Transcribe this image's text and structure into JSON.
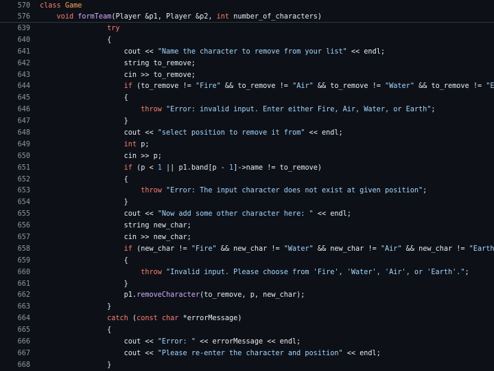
{
  "sticky_header": [
    {
      "line_number": "570",
      "tokens": [
        {
          "t": "class",
          "c": "kw"
        },
        {
          "t": " ",
          "c": "pl"
        },
        {
          "t": "Game",
          "c": "cls"
        }
      ]
    },
    {
      "line_number": "576",
      "tokens": [
        {
          "t": "    ",
          "c": "pl"
        },
        {
          "t": "void",
          "c": "kw"
        },
        {
          "t": " ",
          "c": "pl"
        },
        {
          "t": "formTeam",
          "c": "fn"
        },
        {
          "t": "(Player &p1, Player &p2, ",
          "c": "pl"
        },
        {
          "t": "int",
          "c": "kw"
        },
        {
          "t": " number_of_characters)",
          "c": "pl"
        }
      ]
    }
  ],
  "lines": [
    {
      "line_number": "639",
      "tokens": [
        {
          "t": "                ",
          "c": "pl"
        },
        {
          "t": "try",
          "c": "kw"
        }
      ]
    },
    {
      "line_number": "640",
      "tokens": [
        {
          "t": "                {",
          "c": "pl"
        }
      ]
    },
    {
      "line_number": "641",
      "tokens": [
        {
          "t": "                    cout << ",
          "c": "pl"
        },
        {
          "t": "\"Name the character to remove from your list\"",
          "c": "str"
        },
        {
          "t": " << endl;",
          "c": "pl"
        }
      ]
    },
    {
      "line_number": "642",
      "tokens": [
        {
          "t": "                    string to_remove;",
          "c": "pl"
        }
      ]
    },
    {
      "line_number": "643",
      "tokens": [
        {
          "t": "                    cin >> to_remove;",
          "c": "pl"
        }
      ]
    },
    {
      "line_number": "644",
      "tokens": [
        {
          "t": "                    ",
          "c": "pl"
        },
        {
          "t": "if",
          "c": "kw"
        },
        {
          "t": " (to_remove != ",
          "c": "pl"
        },
        {
          "t": "\"Fire\"",
          "c": "str"
        },
        {
          "t": " && to_remove != ",
          "c": "pl"
        },
        {
          "t": "\"Air\"",
          "c": "str"
        },
        {
          "t": " && to_remove != ",
          "c": "pl"
        },
        {
          "t": "\"Water\"",
          "c": "str"
        },
        {
          "t": " && to_remove != ",
          "c": "pl"
        },
        {
          "t": "\"Earth\"",
          "c": "str"
        },
        {
          "t": ")",
          "c": "pl"
        }
      ]
    },
    {
      "line_number": "645",
      "tokens": [
        {
          "t": "                    {",
          "c": "pl"
        }
      ]
    },
    {
      "line_number": "646",
      "tokens": [
        {
          "t": "                        ",
          "c": "pl"
        },
        {
          "t": "throw",
          "c": "kw"
        },
        {
          "t": " ",
          "c": "pl"
        },
        {
          "t": "\"Error: invalid input. Enter either Fire, Air, Water, or Earth\"",
          "c": "str"
        },
        {
          "t": ";",
          "c": "pl"
        }
      ]
    },
    {
      "line_number": "647",
      "tokens": [
        {
          "t": "                    }",
          "c": "pl"
        }
      ]
    },
    {
      "line_number": "648",
      "tokens": [
        {
          "t": "                    cout << ",
          "c": "pl"
        },
        {
          "t": "\"select position to remove it from\"",
          "c": "str"
        },
        {
          "t": " << endl;",
          "c": "pl"
        }
      ]
    },
    {
      "line_number": "649",
      "tokens": [
        {
          "t": "                    ",
          "c": "pl"
        },
        {
          "t": "int",
          "c": "kw"
        },
        {
          "t": " p;",
          "c": "pl"
        }
      ]
    },
    {
      "line_number": "650",
      "tokens": [
        {
          "t": "                    cin >> p;",
          "c": "pl"
        }
      ]
    },
    {
      "line_number": "651",
      "tokens": [
        {
          "t": "                    ",
          "c": "pl"
        },
        {
          "t": "if",
          "c": "kw"
        },
        {
          "t": " (p < ",
          "c": "pl"
        },
        {
          "t": "1",
          "c": "num"
        },
        {
          "t": " || p1.band[p - ",
          "c": "pl"
        },
        {
          "t": "1",
          "c": "num"
        },
        {
          "t": "]->name != to_remove)",
          "c": "pl"
        }
      ]
    },
    {
      "line_number": "652",
      "tokens": [
        {
          "t": "                    {",
          "c": "pl"
        }
      ]
    },
    {
      "line_number": "653",
      "tokens": [
        {
          "t": "                        ",
          "c": "pl"
        },
        {
          "t": "throw",
          "c": "kw"
        },
        {
          "t": " ",
          "c": "pl"
        },
        {
          "t": "\"Error: The input character does not exist at given position\"",
          "c": "str"
        },
        {
          "t": ";",
          "c": "pl"
        }
      ]
    },
    {
      "line_number": "654",
      "tokens": [
        {
          "t": "                    }",
          "c": "pl"
        }
      ]
    },
    {
      "line_number": "655",
      "tokens": [
        {
          "t": "                    cout << ",
          "c": "pl"
        },
        {
          "t": "\"Now add some other character here: \"",
          "c": "str"
        },
        {
          "t": " << endl;",
          "c": "pl"
        }
      ]
    },
    {
      "line_number": "656",
      "tokens": [
        {
          "t": "                    string new_char;",
          "c": "pl"
        }
      ]
    },
    {
      "line_number": "657",
      "tokens": [
        {
          "t": "                    cin >> new_char;",
          "c": "pl"
        }
      ]
    },
    {
      "line_number": "658",
      "tokens": [
        {
          "t": "                    ",
          "c": "pl"
        },
        {
          "t": "if",
          "c": "kw"
        },
        {
          "t": " (new_char != ",
          "c": "pl"
        },
        {
          "t": "\"Fire\"",
          "c": "str"
        },
        {
          "t": " && new_char != ",
          "c": "pl"
        },
        {
          "t": "\"Water\"",
          "c": "str"
        },
        {
          "t": " && new_char != ",
          "c": "pl"
        },
        {
          "t": "\"Air\"",
          "c": "str"
        },
        {
          "t": " && new_char != ",
          "c": "pl"
        },
        {
          "t": "\"Earth\"",
          "c": "str"
        },
        {
          "t": ")",
          "c": "pl"
        }
      ]
    },
    {
      "line_number": "659",
      "tokens": [
        {
          "t": "                    {",
          "c": "pl"
        }
      ]
    },
    {
      "line_number": "660",
      "tokens": [
        {
          "t": "                        ",
          "c": "pl"
        },
        {
          "t": "throw",
          "c": "kw"
        },
        {
          "t": " ",
          "c": "pl"
        },
        {
          "t": "\"Invalid input. Please choose from 'Fire', 'Water', 'Air', or 'Earth'.\"",
          "c": "str"
        },
        {
          "t": ";",
          "c": "pl"
        }
      ]
    },
    {
      "line_number": "661",
      "tokens": [
        {
          "t": "                    }",
          "c": "pl"
        }
      ]
    },
    {
      "line_number": "662",
      "tokens": [
        {
          "t": "                    p1.",
          "c": "pl"
        },
        {
          "t": "removeCharacter",
          "c": "fn"
        },
        {
          "t": "(to_remove, p, new_char);",
          "c": "pl"
        }
      ]
    },
    {
      "line_number": "663",
      "tokens": [
        {
          "t": "                }",
          "c": "pl"
        }
      ]
    },
    {
      "line_number": "664",
      "tokens": [
        {
          "t": "                ",
          "c": "pl"
        },
        {
          "t": "catch",
          "c": "kw"
        },
        {
          "t": " (",
          "c": "pl"
        },
        {
          "t": "const",
          "c": "kw"
        },
        {
          "t": " ",
          "c": "pl"
        },
        {
          "t": "char",
          "c": "kw"
        },
        {
          "t": " *errorMessage)",
          "c": "pl"
        }
      ]
    },
    {
      "line_number": "665",
      "tokens": [
        {
          "t": "                {",
          "c": "pl"
        }
      ]
    },
    {
      "line_number": "666",
      "tokens": [
        {
          "t": "                    cout << ",
          "c": "pl"
        },
        {
          "t": "\"Error: \"",
          "c": "str"
        },
        {
          "t": " << errorMessage << endl;",
          "c": "pl"
        }
      ]
    },
    {
      "line_number": "667",
      "tokens": [
        {
          "t": "                    cout << ",
          "c": "pl"
        },
        {
          "t": "\"Please re-enter the character and position\"",
          "c": "str"
        },
        {
          "t": " << endl;",
          "c": "pl"
        }
      ]
    },
    {
      "line_number": "668",
      "tokens": [
        {
          "t": "                }",
          "c": "pl"
        }
      ]
    }
  ],
  "colors": {
    "background": "#0d1117",
    "line_number": "#8d96a0",
    "plain": "#e6edf3",
    "keyword": "#ff7b72",
    "function": "#d2a8ff",
    "string": "#a5d6ff",
    "number": "#79c0ff",
    "class": "#ffa657"
  }
}
